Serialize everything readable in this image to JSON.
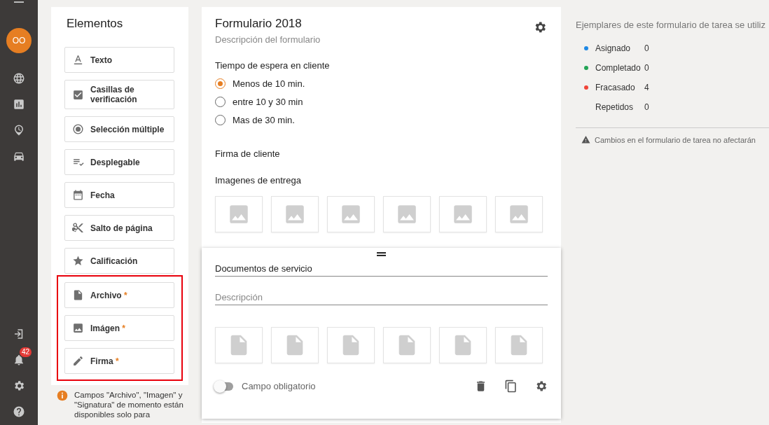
{
  "sidebar": {
    "avatar": "OO",
    "top_items": [
      {
        "kind": "globe"
      },
      {
        "kind": "chart"
      },
      {
        "kind": "clock"
      },
      {
        "kind": "car"
      }
    ],
    "bottom_items": [
      {
        "kind": "exit"
      },
      {
        "kind": "bell",
        "badge": "42"
      },
      {
        "kind": "gear"
      },
      {
        "kind": "help"
      }
    ]
  },
  "elements": {
    "title": "Elementos",
    "groups": [
      {
        "highlighted": false,
        "items": [
          {
            "kind": "text",
            "label": "Texto"
          },
          {
            "kind": "checkbox",
            "label": "Casillas de verificación"
          },
          {
            "kind": "radio",
            "label": "Selección múltiple"
          },
          {
            "kind": "dropdown",
            "label": "Desplegable"
          },
          {
            "kind": "date",
            "label": "Fecha"
          },
          {
            "kind": "pagebreak",
            "label": "Salto de página"
          },
          {
            "kind": "rating",
            "label": "Calificación"
          }
        ]
      },
      {
        "highlighted": true,
        "items": [
          {
            "kind": "file",
            "label": "Archivo",
            "mark": "*"
          },
          {
            "kind": "image",
            "label": "Imágen",
            "mark": "*"
          },
          {
            "kind": "signature",
            "label": "Firma",
            "mark": "*"
          }
        ]
      }
    ],
    "note": "Campos \"Archivo\", \"Imagen\" y \"Signatura\" de momento están disponibles solo para"
  },
  "form": {
    "title": "Formulario 2018",
    "description": "Descripción del formulario",
    "question": {
      "label": "Tiempo de espera en cliente",
      "options": [
        {
          "label": "Menos de 10 min.",
          "selected": true
        },
        {
          "label": "entre 10 y 30 min",
          "selected": false
        },
        {
          "label": "Mas de 30 min.",
          "selected": false
        }
      ]
    },
    "signature_label": "Firma de cliente",
    "images_label": "Imagenes de entrega",
    "active_field": {
      "title": "Documentos de servicio",
      "description_placeholder": "Descripción",
      "required_label": "Campo obligatorio",
      "required": false
    }
  },
  "info": {
    "title": "Ejemplares de este formulario de tarea se utiliz",
    "stats": [
      {
        "label": "Asignado",
        "value": "0",
        "color": "#1e88e5"
      },
      {
        "label": "Completado",
        "value": "0",
        "color": "#23a455"
      },
      {
        "label": "Fracasado",
        "value": "4",
        "color": "#f04438"
      },
      {
        "label": "Repetidos",
        "value": "0"
      }
    ],
    "warning": "Cambios en el formulario de tarea no afectarán"
  }
}
